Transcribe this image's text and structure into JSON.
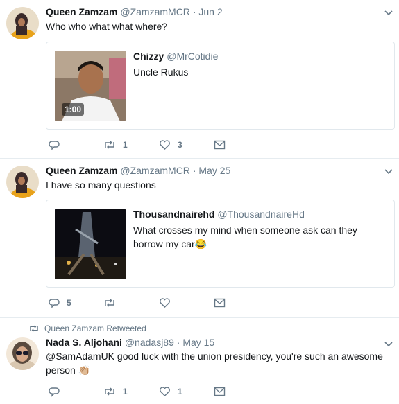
{
  "colors": {
    "muted": "#657786",
    "border": "#e1e8ed",
    "text": "#14171a"
  },
  "tweets": [
    {
      "name": "Queen Zamzam",
      "handle": "@ZamzamMCR",
      "date": "· Jun 2",
      "text": "Who who what what where?",
      "quote": {
        "name": "Chizzy",
        "handle": "@MrCotidie",
        "text": "Uncle Rukus",
        "media_duration": "1:00"
      },
      "actions": {
        "reply": "",
        "retweet": "1",
        "like": "3"
      }
    },
    {
      "name": "Queen Zamzam",
      "handle": "@ZamzamMCR",
      "date": "· May 25",
      "text": "I have so many questions",
      "quote": {
        "name": "Thousandnairehd",
        "handle": "@ThousandnaireHd",
        "text": "What crosses my mind when someone ask can they borrow my car",
        "emoji": "😂"
      },
      "actions": {
        "reply": "5",
        "retweet": "",
        "like": ""
      }
    },
    {
      "retweeted_by": "Queen Zamzam Retweeted",
      "name": "Nada S. Aljohani",
      "handle": "@nadasj89",
      "date": "· May 15",
      "text": "@SamAdamUK good luck with the union presidency, you're such an awesome person",
      "emoji": "👏🏼",
      "actions": {
        "reply": "",
        "retweet": "1",
        "like": "1"
      }
    }
  ],
  "icons": [
    "reply-icon",
    "retweet-icon",
    "like-icon",
    "dm-icon",
    "chevron-down-icon"
  ]
}
